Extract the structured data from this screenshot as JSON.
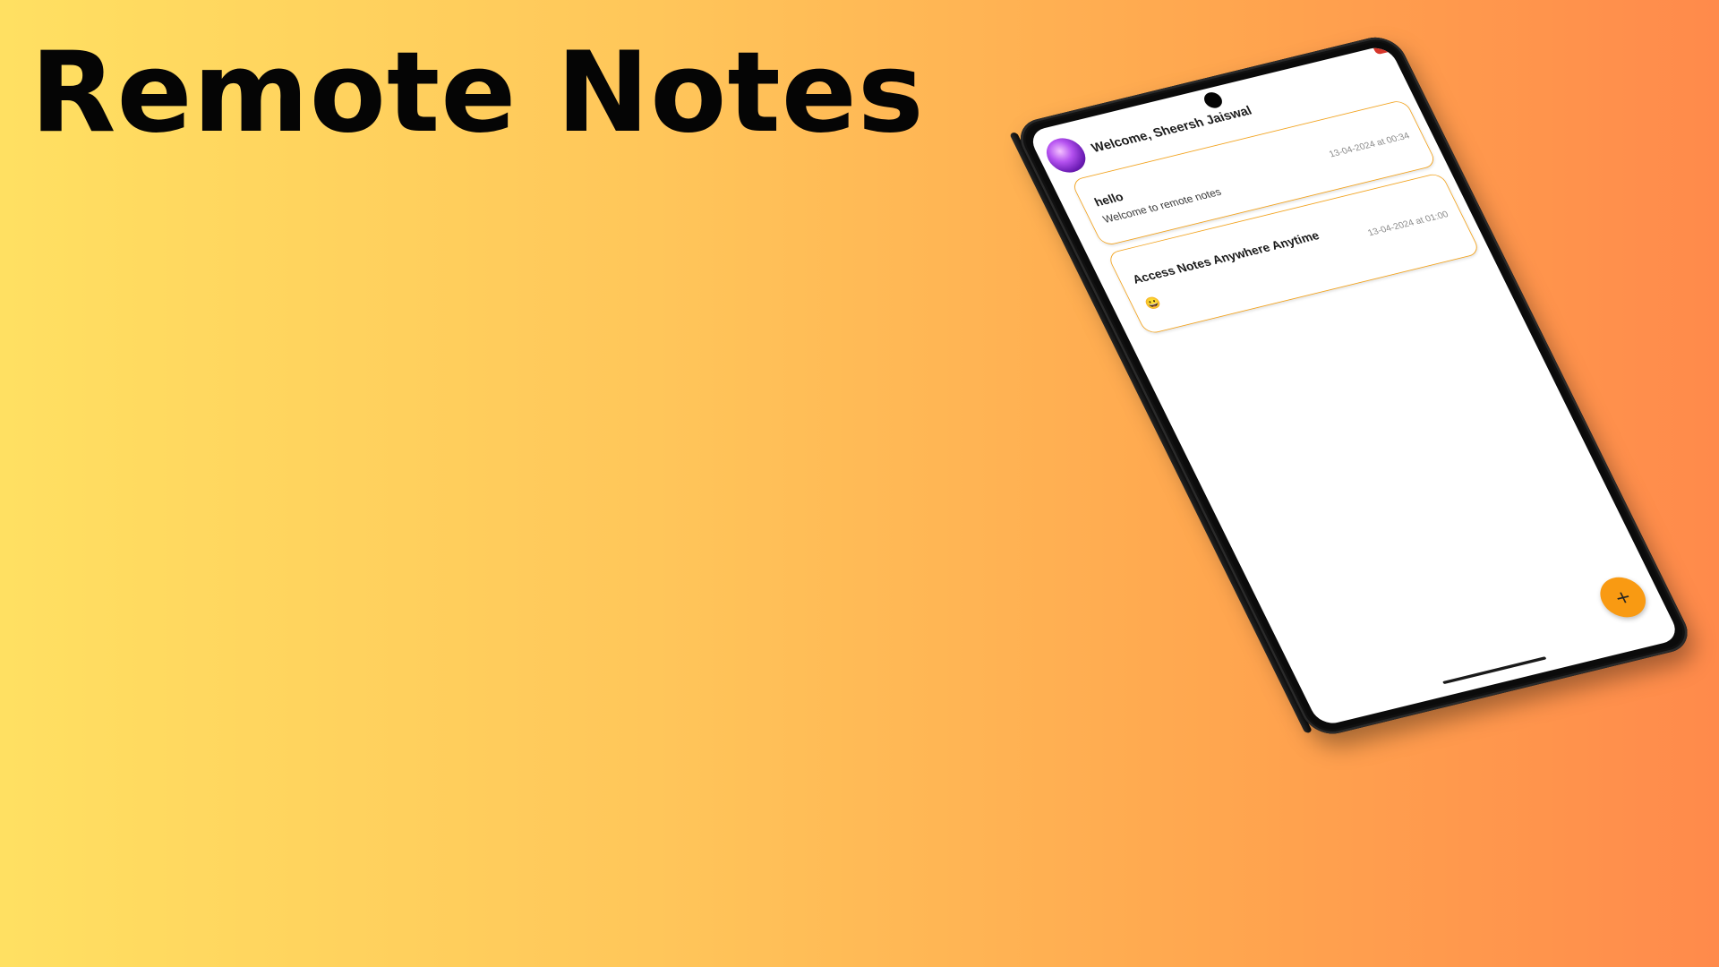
{
  "headline": "Remote Notes",
  "app": {
    "welcome_text": "Welcome, Sheersh Jaiswal",
    "avatar_icon": "avatar-image",
    "notes": [
      {
        "title": "hello",
        "body": "Welcome to remote notes",
        "date": "13-04-2024 at 00:34"
      },
      {
        "title": "Access Notes Anywhere Anytime",
        "body": "😀",
        "date": "13-04-2024 at 01:00"
      }
    ],
    "fab_label": "+",
    "fab_icon": "plus-icon"
  },
  "colors": {
    "accent": "#f99a12",
    "card_border": "#f3a21a",
    "background_start": "#ffe062",
    "background_end": "#ff8a4b"
  }
}
